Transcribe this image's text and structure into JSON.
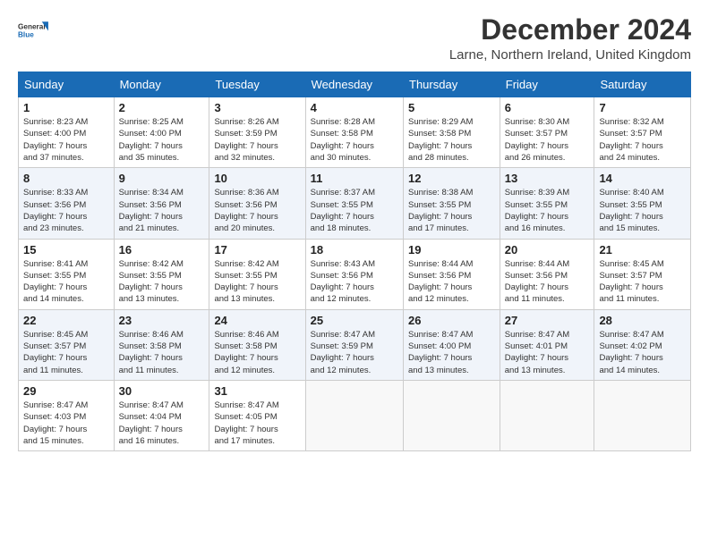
{
  "header": {
    "logo_line1": "General",
    "logo_line2": "Blue",
    "month_title": "December 2024",
    "location": "Larne, Northern Ireland, United Kingdom"
  },
  "days_of_week": [
    "Sunday",
    "Monday",
    "Tuesday",
    "Wednesday",
    "Thursday",
    "Friday",
    "Saturday"
  ],
  "weeks": [
    [
      {
        "day": "1",
        "info": "Sunrise: 8:23 AM\nSunset: 4:00 PM\nDaylight: 7 hours\nand 37 minutes."
      },
      {
        "day": "2",
        "info": "Sunrise: 8:25 AM\nSunset: 4:00 PM\nDaylight: 7 hours\nand 35 minutes."
      },
      {
        "day": "3",
        "info": "Sunrise: 8:26 AM\nSunset: 3:59 PM\nDaylight: 7 hours\nand 32 minutes."
      },
      {
        "day": "4",
        "info": "Sunrise: 8:28 AM\nSunset: 3:58 PM\nDaylight: 7 hours\nand 30 minutes."
      },
      {
        "day": "5",
        "info": "Sunrise: 8:29 AM\nSunset: 3:58 PM\nDaylight: 7 hours\nand 28 minutes."
      },
      {
        "day": "6",
        "info": "Sunrise: 8:30 AM\nSunset: 3:57 PM\nDaylight: 7 hours\nand 26 minutes."
      },
      {
        "day": "7",
        "info": "Sunrise: 8:32 AM\nSunset: 3:57 PM\nDaylight: 7 hours\nand 24 minutes."
      }
    ],
    [
      {
        "day": "8",
        "info": "Sunrise: 8:33 AM\nSunset: 3:56 PM\nDaylight: 7 hours\nand 23 minutes."
      },
      {
        "day": "9",
        "info": "Sunrise: 8:34 AM\nSunset: 3:56 PM\nDaylight: 7 hours\nand 21 minutes."
      },
      {
        "day": "10",
        "info": "Sunrise: 8:36 AM\nSunset: 3:56 PM\nDaylight: 7 hours\nand 20 minutes."
      },
      {
        "day": "11",
        "info": "Sunrise: 8:37 AM\nSunset: 3:55 PM\nDaylight: 7 hours\nand 18 minutes."
      },
      {
        "day": "12",
        "info": "Sunrise: 8:38 AM\nSunset: 3:55 PM\nDaylight: 7 hours\nand 17 minutes."
      },
      {
        "day": "13",
        "info": "Sunrise: 8:39 AM\nSunset: 3:55 PM\nDaylight: 7 hours\nand 16 minutes."
      },
      {
        "day": "14",
        "info": "Sunrise: 8:40 AM\nSunset: 3:55 PM\nDaylight: 7 hours\nand 15 minutes."
      }
    ],
    [
      {
        "day": "15",
        "info": "Sunrise: 8:41 AM\nSunset: 3:55 PM\nDaylight: 7 hours\nand 14 minutes."
      },
      {
        "day": "16",
        "info": "Sunrise: 8:42 AM\nSunset: 3:55 PM\nDaylight: 7 hours\nand 13 minutes."
      },
      {
        "day": "17",
        "info": "Sunrise: 8:42 AM\nSunset: 3:55 PM\nDaylight: 7 hours\nand 13 minutes."
      },
      {
        "day": "18",
        "info": "Sunrise: 8:43 AM\nSunset: 3:56 PM\nDaylight: 7 hours\nand 12 minutes."
      },
      {
        "day": "19",
        "info": "Sunrise: 8:44 AM\nSunset: 3:56 PM\nDaylight: 7 hours\nand 12 minutes."
      },
      {
        "day": "20",
        "info": "Sunrise: 8:44 AM\nSunset: 3:56 PM\nDaylight: 7 hours\nand 11 minutes."
      },
      {
        "day": "21",
        "info": "Sunrise: 8:45 AM\nSunset: 3:57 PM\nDaylight: 7 hours\nand 11 minutes."
      }
    ],
    [
      {
        "day": "22",
        "info": "Sunrise: 8:45 AM\nSunset: 3:57 PM\nDaylight: 7 hours\nand 11 minutes."
      },
      {
        "day": "23",
        "info": "Sunrise: 8:46 AM\nSunset: 3:58 PM\nDaylight: 7 hours\nand 11 minutes."
      },
      {
        "day": "24",
        "info": "Sunrise: 8:46 AM\nSunset: 3:58 PM\nDaylight: 7 hours\nand 12 minutes."
      },
      {
        "day": "25",
        "info": "Sunrise: 8:47 AM\nSunset: 3:59 PM\nDaylight: 7 hours\nand 12 minutes."
      },
      {
        "day": "26",
        "info": "Sunrise: 8:47 AM\nSunset: 4:00 PM\nDaylight: 7 hours\nand 13 minutes."
      },
      {
        "day": "27",
        "info": "Sunrise: 8:47 AM\nSunset: 4:01 PM\nDaylight: 7 hours\nand 13 minutes."
      },
      {
        "day": "28",
        "info": "Sunrise: 8:47 AM\nSunset: 4:02 PM\nDaylight: 7 hours\nand 14 minutes."
      }
    ],
    [
      {
        "day": "29",
        "info": "Sunrise: 8:47 AM\nSunset: 4:03 PM\nDaylight: 7 hours\nand 15 minutes."
      },
      {
        "day": "30",
        "info": "Sunrise: 8:47 AM\nSunset: 4:04 PM\nDaylight: 7 hours\nand 16 minutes."
      },
      {
        "day": "31",
        "info": "Sunrise: 8:47 AM\nSunset: 4:05 PM\nDaylight: 7 hours\nand 17 minutes."
      },
      {
        "day": "",
        "info": ""
      },
      {
        "day": "",
        "info": ""
      },
      {
        "day": "",
        "info": ""
      },
      {
        "day": "",
        "info": ""
      }
    ]
  ]
}
